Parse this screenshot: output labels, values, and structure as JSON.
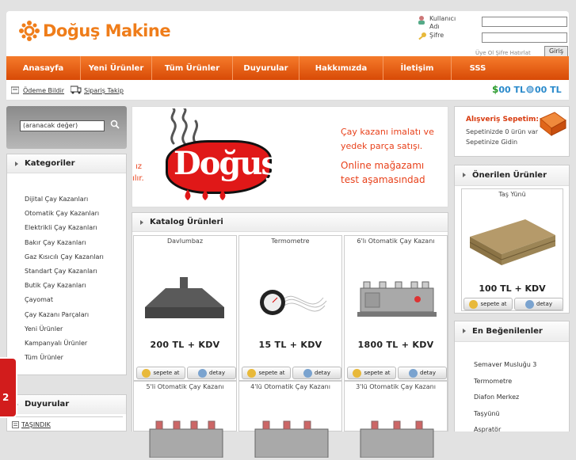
{
  "brand": {
    "name": "Doğuş Makine"
  },
  "login": {
    "user_label_1": "Kullanıcı",
    "user_label_2": "Adı",
    "pass_label": "Şifre",
    "links": "Üye Ol Şifre Hatırlat",
    "button": "Giriş"
  },
  "nav": [
    "Anasayfa",
    "Yeni Ürünler",
    "Tüm Ürünler",
    "Duyurular",
    "Hakkımızda",
    "İletişim",
    "SSS"
  ],
  "subbar": {
    "payment": "Ödeme Bildir",
    "order_track": "Sipariş Takip",
    "money_1": "00 TL",
    "money_2": "00 TL"
  },
  "search": {
    "value": "(aranacak değer)"
  },
  "categories": {
    "title": "Kategoriler",
    "items": [
      "Dijital Çay Kazanları",
      "Otomatik Çay Kazanları",
      "Elektrikli Çay Kazanları",
      "Bakır Çay Kazanları",
      "Gaz Kısıcılı Çay Kazanları",
      "Standart Çay Kazanları",
      "Butik Çay Kazanları",
      "Çayomat",
      "Çay Kazanı Parçaları",
      "Yeni Ürünler",
      "Kampanyalı Ürünler",
      "Tüm Ürünler"
    ]
  },
  "announcements": {
    "title": "Duyurular",
    "item": "TAŞINDIK"
  },
  "banner": {
    "brand": "Doğuş",
    "left_frag_1": "ız",
    "left_frag_2": "ılır.",
    "line1": "Çay kazanı imalatı ve",
    "line2": "yedek parça satışı.",
    "line3": "Online mağazamı",
    "line4": "test aşamasındad"
  },
  "catalog": {
    "title": "Katalog Ürünleri",
    "cart_label": "sepete at",
    "detail_label": "detay",
    "products": [
      {
        "name": "Davlumbaz",
        "price": "200 TL + KDV"
      },
      {
        "name": "Termometre",
        "price": "15 TL + KDV"
      },
      {
        "name": "6'lı Otomatik Çay Kazanı",
        "price": "1800 TL + KDV"
      },
      {
        "name": "5'li Otomatik Çay Kazanı",
        "price": ""
      },
      {
        "name": "4'lü Otomatik Çay Kazanı",
        "price": ""
      },
      {
        "name": "3'lü Otomatik Çay Kazanı",
        "price": ""
      }
    ]
  },
  "cart": {
    "title": "Alışveriş Sepetim:",
    "line1": "Sepetinizde 0 ürün var",
    "line2": "Sepetinize Gidin"
  },
  "recommended": {
    "title": "Önerilen Ürünler",
    "product": "Taş Yünü",
    "price": "100 TL + KDV"
  },
  "liked": {
    "title": "En Beğenilenler",
    "items": [
      "Semaver Musluğu 3",
      "Termometre",
      "Diafon Merkez",
      "Taşyünü",
      "Aspratör"
    ]
  },
  "side_tab": {
    "label": "2"
  }
}
